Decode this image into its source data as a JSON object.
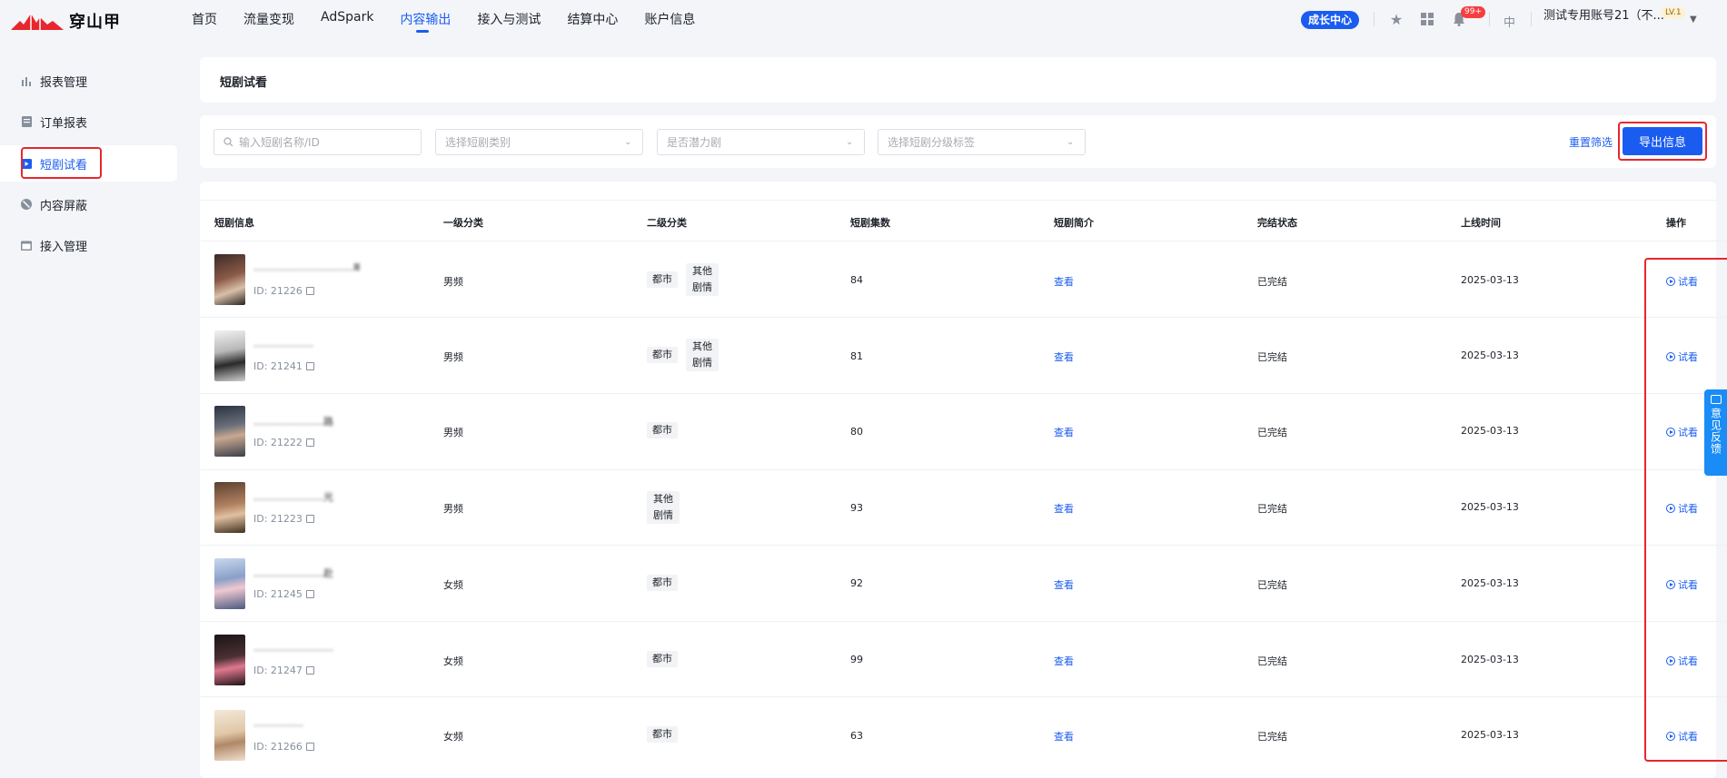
{
  "brand": {
    "name": "穿山甲",
    "color": "#e8262e"
  },
  "nav": {
    "items": [
      "首页",
      "流量变现",
      "AdSpark",
      "内容输出",
      "接入与测试",
      "结算中心",
      "账户信息"
    ],
    "active_index": 3
  },
  "header": {
    "growth_center": "成长中心",
    "notification_badge": "99+",
    "lang": "中",
    "account": "测试专用账号21（不...",
    "level": "LV.1"
  },
  "sidebar": {
    "items": [
      {
        "label": "报表管理",
        "icon": "bar-chart-icon"
      },
      {
        "label": "订单报表",
        "icon": "document-icon"
      },
      {
        "label": "短剧试看",
        "icon": "play-icon"
      },
      {
        "label": "内容屏蔽",
        "icon": "block-icon"
      },
      {
        "label": "接入管理",
        "icon": "calendar-icon"
      }
    ],
    "active_index": 2
  },
  "page": {
    "title": "短剧试看"
  },
  "filters": {
    "search_placeholder": "输入短剧名称/ID",
    "category_placeholder": "选择短剧类别",
    "potential_placeholder": "是否潜力剧",
    "tag_placeholder": "选择短剧分级标签",
    "reset": "重置筛选",
    "export": "导出信息"
  },
  "table": {
    "headers": [
      "短剧信息",
      "一级分类",
      "二级分类",
      "短剧集数",
      "短剧简介",
      "完结状态",
      "上线时间",
      "操作"
    ],
    "view_label": "查看",
    "try_label": "试看",
    "rows": [
      {
        "title": "…………………………Ⅲ",
        "id": "ID: 21226",
        "level1": "男频",
        "level2": [
          "都市",
          "其他剧情"
        ],
        "episodes": "84",
        "status": "已完结",
        "date": "2025-03-13"
      },
      {
        "title": "………………",
        "id": "ID: 21241",
        "level1": "男频",
        "level2": [
          "都市",
          "其他剧情"
        ],
        "episodes": "81",
        "status": "已完结",
        "date": "2025-03-13"
      },
      {
        "title": "…………………路",
        "id": "ID: 21222",
        "level1": "男频",
        "level2": [
          "都市"
        ],
        "episodes": "80",
        "status": "已完结",
        "date": "2025-03-13"
      },
      {
        "title": "…………………光",
        "id": "ID: 21223",
        "level1": "男频",
        "level2": [
          "其他剧情"
        ],
        "episodes": "93",
        "status": "已完结",
        "date": "2025-03-13"
      },
      {
        "title": "…………………赴",
        "id": "ID: 21245",
        "level1": "女频",
        "level2": [
          "都市"
        ],
        "episodes": "92",
        "status": "已完结",
        "date": "2025-03-13"
      },
      {
        "title": "……………………",
        "id": "ID: 21247",
        "level1": "女频",
        "level2": [
          "都市"
        ],
        "episodes": "99",
        "status": "已完结",
        "date": "2025-03-13"
      },
      {
        "title": "……………",
        "id": "ID: 21266",
        "level1": "女频",
        "level2": [
          "都市"
        ],
        "episodes": "63",
        "status": "已完结",
        "date": "2025-03-13"
      }
    ]
  },
  "feedback": {
    "label": "意见反馈"
  }
}
